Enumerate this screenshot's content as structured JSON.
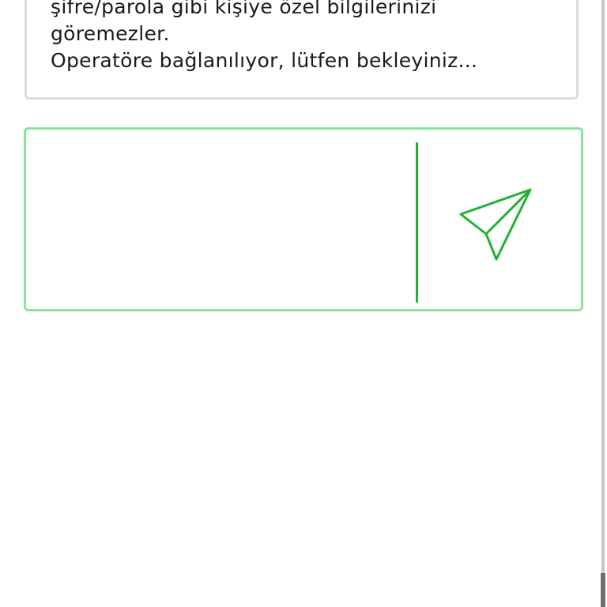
{
  "message": {
    "lines": [
      "şifre/parola gibi kişiye özel bilgilerinizi",
      "göremezler.",
      "Operatöre bağlanılıyor, lütfen bekleyiniz..."
    ]
  },
  "composer": {
    "value": "",
    "placeholder": ""
  },
  "icons": {
    "send": "paper-plane-icon"
  },
  "colors": {
    "accent": "#1fb333",
    "composer_border": "#8ee39a",
    "card_border": "#dcdcd6"
  }
}
